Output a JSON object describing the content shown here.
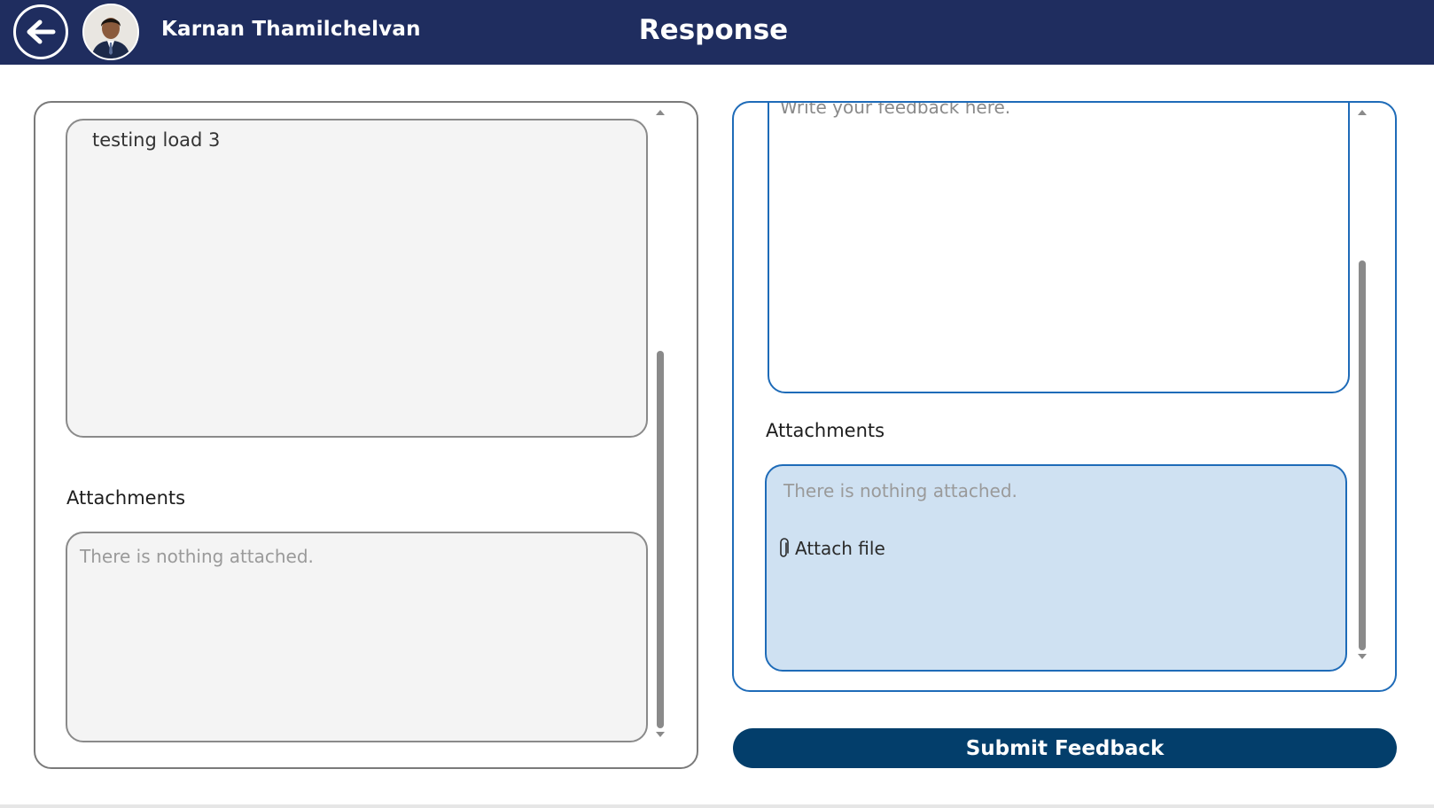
{
  "header": {
    "user_name": "Karnan Thamilchelvan",
    "title": "Response",
    "background_color": "#1f2d5f",
    "back_icon": "arrow-left-icon"
  },
  "left_panel": {
    "message": "testing load 3",
    "attachments_label": "Attachments",
    "attachments_empty": "There is nothing attached."
  },
  "right_panel": {
    "feedback_placeholder": "Write your feedback here.",
    "attachments_label": "Attachments",
    "attachments_empty": "There is nothing attached.",
    "attach_file_label": "Attach file",
    "attach_icon": "paperclip-icon"
  },
  "submit_label": "Submit Feedback",
  "colors": {
    "accent": "#1e6bb8",
    "submit": "#033e6b",
    "attach_box": "#cfe1f2"
  }
}
